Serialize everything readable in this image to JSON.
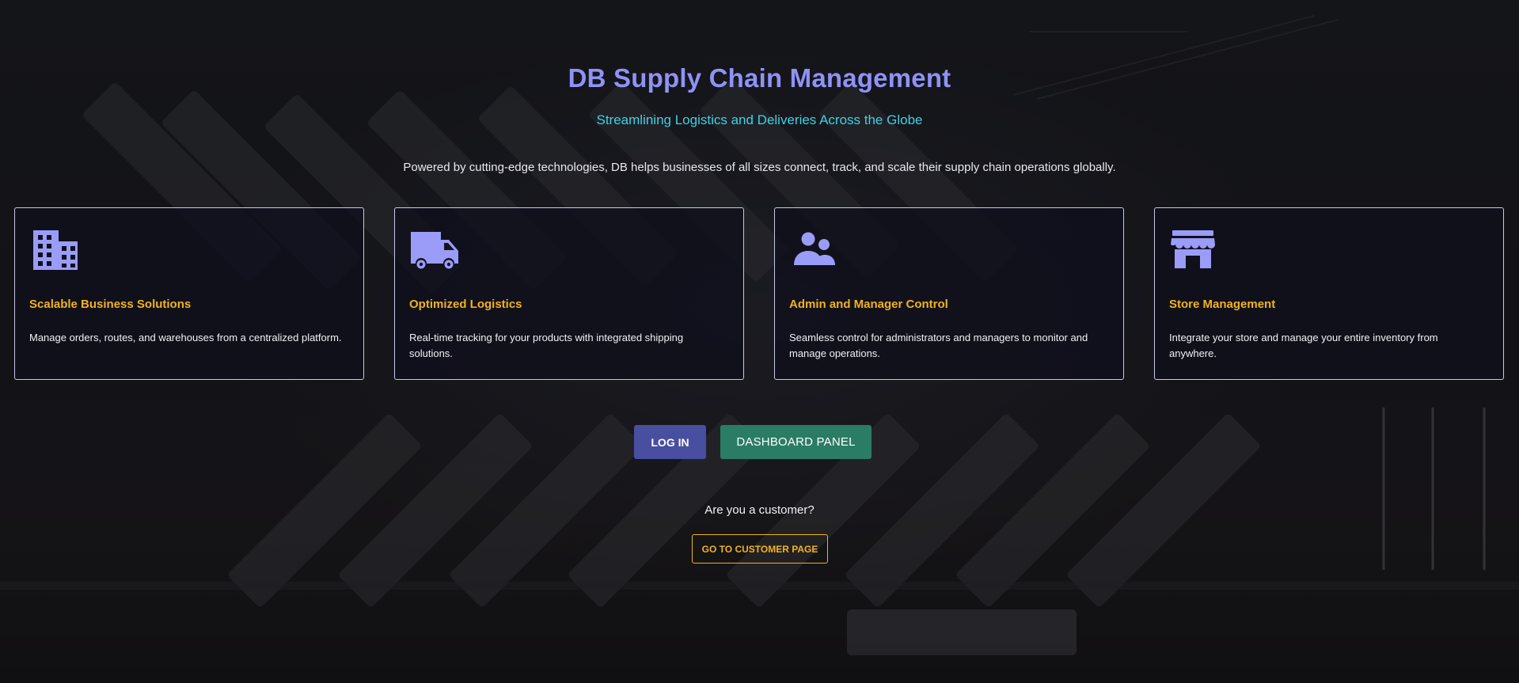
{
  "hero": {
    "title": "DB Supply Chain Management",
    "subtitle": "Streamlining Logistics and Deliveries Across the Globe",
    "description": "Powered by cutting-edge technologies, DB helps businesses of all sizes connect, track, and scale their supply chain operations globally."
  },
  "features": [
    {
      "icon": "building-icon",
      "title": "Scalable Business Solutions",
      "text": "Manage orders, routes, and warehouses from a centralized platform."
    },
    {
      "icon": "truck-icon",
      "title": "Optimized Logistics",
      "text": "Real-time tracking for your products with integrated shipping solutions."
    },
    {
      "icon": "users-icon",
      "title": "Admin and Manager Control",
      "text": "Seamless control for administrators and managers to monitor and manage operations."
    },
    {
      "icon": "store-icon",
      "title": "Store Management",
      "text": "Integrate your store and manage your entire inventory from anywhere."
    }
  ],
  "actions": {
    "login_label": "LOG IN",
    "dashboard_label": "DASHBOARD PANEL"
  },
  "customer": {
    "question": "Are you a customer?",
    "button_label": "GO TO CUSTOMER PAGE"
  },
  "colors": {
    "title": "#8f92f5",
    "subtitle": "#3fd0e6",
    "card_title": "#f2b21c",
    "icon": "#9a9cf7",
    "login_button": "#484ea0",
    "dashboard_button": "#2b7c64",
    "customer_button_border": "#f2b21c"
  }
}
